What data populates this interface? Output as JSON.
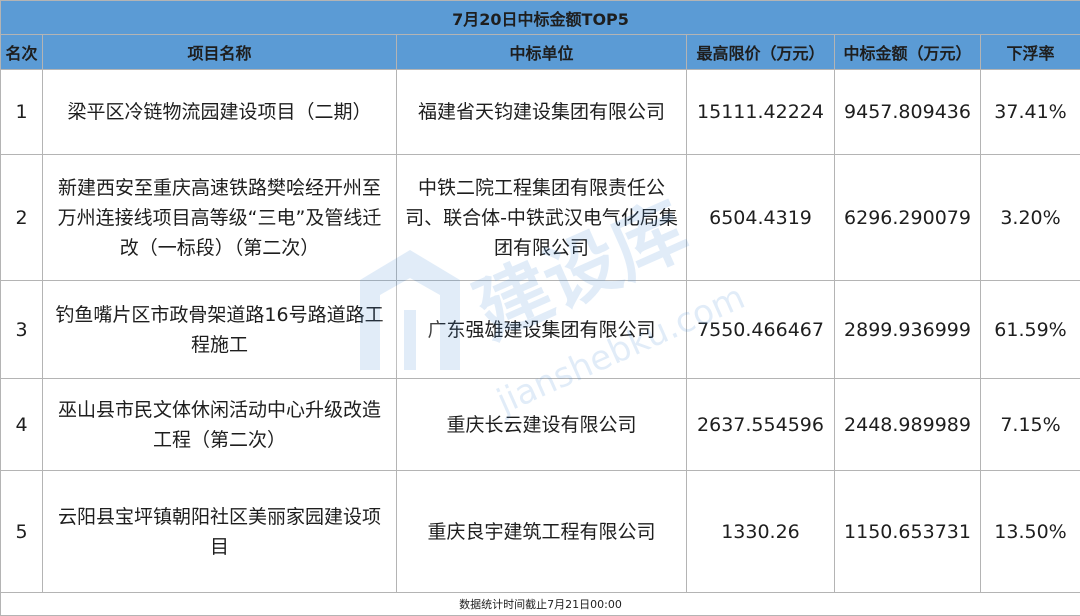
{
  "table": {
    "title": "7月20日中标金额TOP5",
    "headers": [
      "名次",
      "项目名称",
      "中标单位",
      "最高限价（万元）",
      "中标金额（万元）",
      "下浮率"
    ],
    "rows": [
      [
        "1",
        "梁平区冷链物流园建设项目（二期）",
        "福建省天钧建设集团有限公司",
        "15111.42224",
        "9457.809436",
        "37.41%"
      ],
      [
        "2",
        "新建西安至重庆高速铁路樊哙经开州至万州连接线项目高等级“三电”及管线迁改（一标段）（第二次）",
        "中铁二院工程集团有限责任公司、联合体-中铁武汉电气化局集团有限公司",
        "6504.4319",
        "6296.290079",
        "3.20%"
      ],
      [
        "3",
        "钓鱼嘴片区市政骨架道路16号路道路工程施工",
        "广东强雄建设集团有限公司",
        "7550.466467",
        "2899.936999",
        "61.59%"
      ],
      [
        "4",
        "巫山县市民文体休闲活动中心升级改造工程（第二次）",
        "重庆长云建设有限公司",
        "2637.554596",
        "2448.989989",
        "7.15%"
      ],
      [
        "5",
        "云阳县宝坪镇朝阳社区美丽家园建设项目",
        "重庆良宇建筑工程有限公司",
        "1330.26",
        "1150.653731",
        "13.50%"
      ]
    ],
    "footnote": "数据统计时间截止7月21日00:00"
  },
  "watermark": {
    "brand": "建设库",
    "domain": "jianshebku.com",
    "color": "#4a90d9"
  }
}
